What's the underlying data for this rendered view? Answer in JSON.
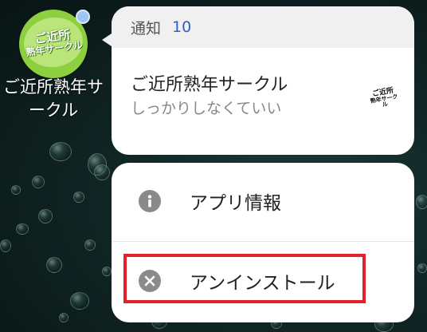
{
  "app": {
    "label": "ご近所熟年サークル",
    "icon_line1": "ご近所",
    "icon_line2": "熟年サークル",
    "badge_color": "#9cc7f5",
    "icon_color": "#8dcf3e"
  },
  "notification": {
    "title": "通知",
    "count": "10",
    "app_name": "ご近所熟年サークル",
    "message": "しっかりしなくていい",
    "thumb_line1": "ご近所",
    "thumb_line2": "熟年サークル"
  },
  "menu": {
    "items": [
      {
        "label": "アプリ情報",
        "icon": "info-icon"
      },
      {
        "label": "アンインストール",
        "icon": "close-circle-icon"
      }
    ]
  },
  "colors": {
    "accent_count": "#2f5fc2",
    "highlight": "#e0222a"
  }
}
